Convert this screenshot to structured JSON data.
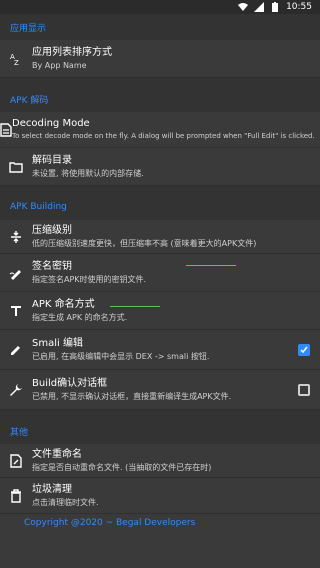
{
  "status": {
    "time": "10:55"
  },
  "sections": {
    "display": {
      "header": "应用显示"
    },
    "decode": {
      "header": "APK 解码"
    },
    "build": {
      "header": "APK Building"
    },
    "other": {
      "header": "其他"
    }
  },
  "items": {
    "sort": {
      "title": "应用列表排序方式",
      "summary": "By App Name"
    },
    "decoding_mode": {
      "title": "Decoding Mode",
      "summary": "To select decode mode on the fly. A dialog will be prompted when \"Full Edit\" is clicked."
    },
    "decode_dir": {
      "title": "解码目录",
      "summary": "未设置, 将使用默认的内部存储."
    },
    "compress": {
      "title": "压缩级别",
      "summary": "低的压缩级别速度更快，但压缩率不高 (意味着更大的APK文件)"
    },
    "signing_key": {
      "title": "签名密钥",
      "summary": "指定签名APK时使用的密钥文件."
    },
    "apk_naming": {
      "title": "APK 命名方式",
      "summary": "指定生成 APK 的命名方式."
    },
    "smali": {
      "title": "Smali 编辑",
      "summary": "已启用, 在高级编辑中会显示 DEX -> smali 按钮.",
      "checked": true
    },
    "build_confirm": {
      "title": "Build确认对话框",
      "summary": "已禁用, 不显示确认对话框，直接重新编译生成APK文件.",
      "checked": false
    },
    "file_rename": {
      "title": "文件重命名",
      "summary": "指定是否自动重命名文件. (当抽取的文件已存在时)"
    },
    "trash": {
      "title": "垃圾清理",
      "summary": "点击清理临时文件."
    }
  },
  "footer": {
    "copyright": "Copyright @2020 ~ Begal Developers"
  },
  "colors": {
    "accent": "#2f8cff",
    "background": "#3a3a3a",
    "divider": "#333333"
  }
}
